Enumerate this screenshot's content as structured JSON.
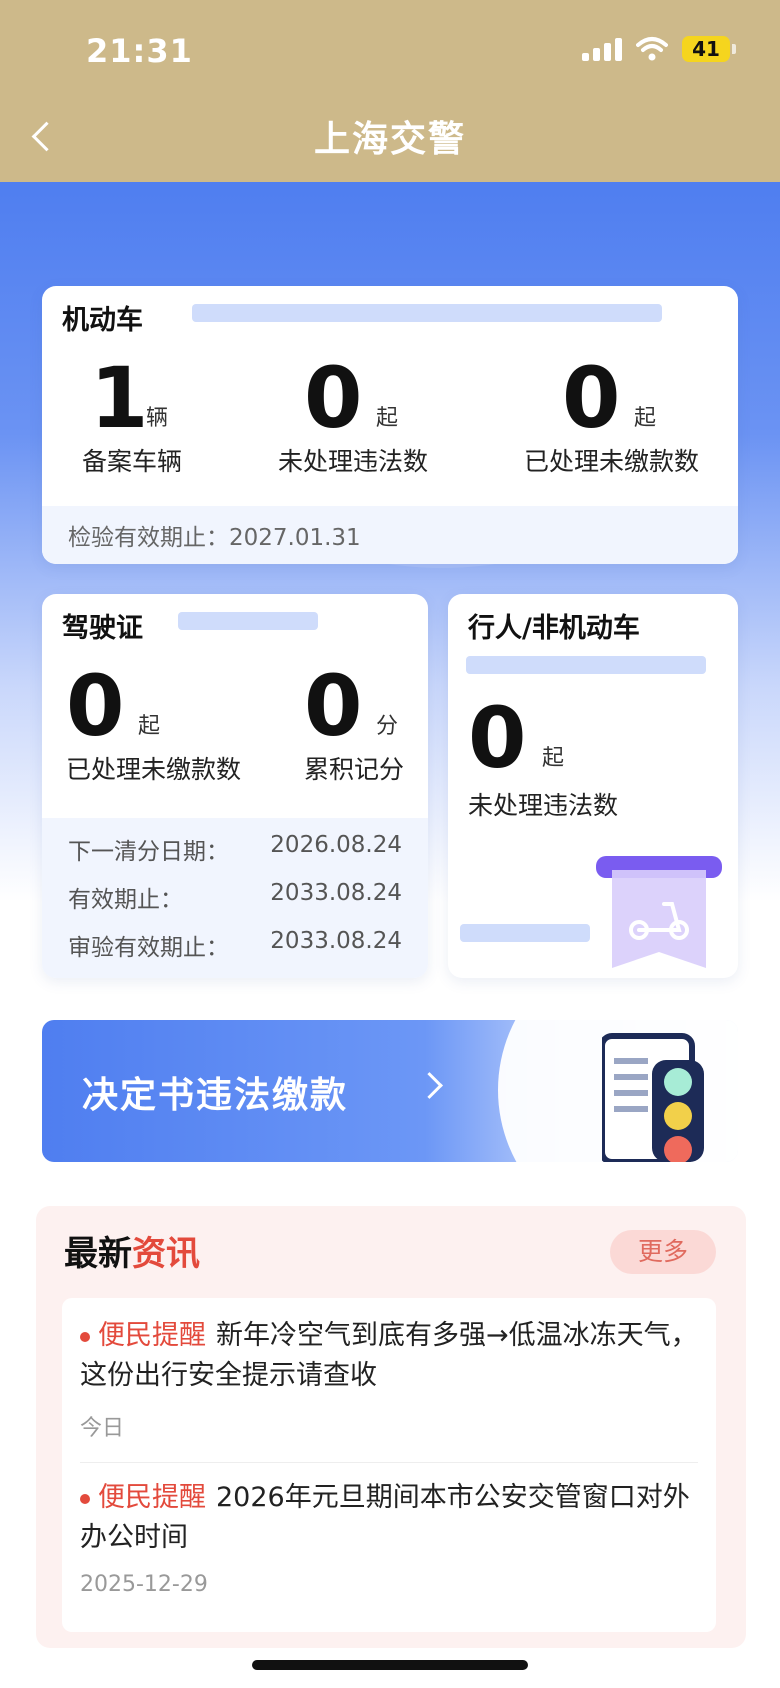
{
  "status_bar": {
    "time": "21:31",
    "battery": "41"
  },
  "header": {
    "title": "上海交警"
  },
  "motor_vehicle": {
    "title": "机动车",
    "stats": [
      {
        "value": "1",
        "unit": "辆",
        "label": "备案车辆"
      },
      {
        "value": "0",
        "unit": "起",
        "label": "未处理违法数"
      },
      {
        "value": "0",
        "unit": "起",
        "label": "已处理未缴款数"
      }
    ],
    "inspection": "检验有效期止：2027.01.31"
  },
  "license": {
    "title": "驾驶证",
    "stats": [
      {
        "value": "0",
        "unit": "起",
        "label": "已处理未缴款数"
      },
      {
        "value": "0",
        "unit": "分",
        "label": "累积记分"
      }
    ],
    "rows": [
      {
        "label": "下一清分日期：",
        "value": "2026.08.24"
      },
      {
        "label": "有效期止：",
        "value": "2033.08.24"
      },
      {
        "label": "审验有效期止：",
        "value": "2033.08.24"
      }
    ]
  },
  "pedestrian": {
    "title": "行人/非机动车",
    "value": "0",
    "unit": "起",
    "label": "未处理违法数"
  },
  "pay_banner": {
    "label": "决定书违法缴款"
  },
  "news": {
    "title_black": "最新",
    "title_red": "资讯",
    "more": "更多",
    "items": [
      {
        "tag": "便民提醒",
        "text": "新年冷空气到底有多强→低温冰冻天气，这份出行安全提示请查收",
        "date": "今日"
      },
      {
        "tag": "便民提醒",
        "text": "2026年元旦期间本市公安交管窗口对外办公时间",
        "date": "2025-12-29"
      }
    ]
  },
  "colors": {
    "header": "#cdb98a",
    "primary_blue": "#4f7ef0",
    "accent_red": "#e34a3c"
  }
}
